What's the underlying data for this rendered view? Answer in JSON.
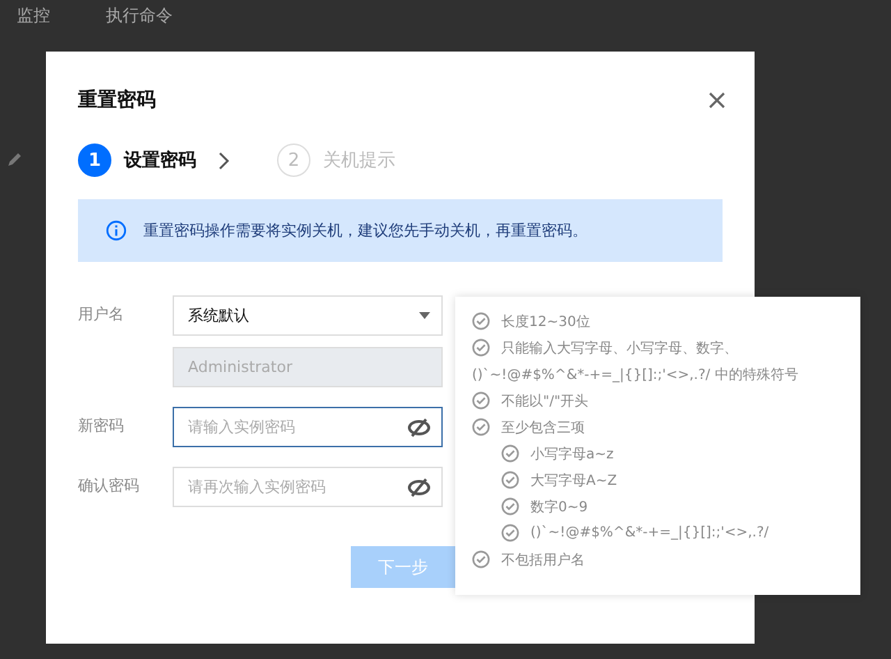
{
  "page_tabs": [
    {
      "label": "监控",
      "selected": false
    },
    {
      "label": "执行命令",
      "selected": false
    }
  ],
  "dialog": {
    "title": "重置密码",
    "steps": [
      {
        "number": "1",
        "label": "设置密码",
        "selected": true
      },
      {
        "number": "2",
        "label": "关机提示",
        "selected": false
      }
    ],
    "notice": "重置密码操作需要将实例关机，建议您先手动关机，再重置密码。",
    "form": {
      "username_label": "用户名",
      "username_select": "系统默认",
      "username_value": "Administrator",
      "new_password_label": "新密码",
      "new_password_placeholder": "请输入实例密码",
      "confirm_password_label": "确认密码",
      "confirm_password_placeholder": "请再次输入实例密码"
    },
    "next_button": "下一步"
  },
  "password_rules": [
    {
      "text": "长度12~30位",
      "met": false
    },
    {
      "text": "只能输入大写字母、小写字母、数字、",
      "continuation": "()`~!@#$%^&*-+=_|{}[]:;'<>,.?/ 中的特殊符号",
      "met": false
    },
    {
      "text": "不能以\"/\"开头",
      "met": false
    },
    {
      "text": "至少包含三项",
      "met": false,
      "children": [
        {
          "text": "小写字母a~z",
          "met": false
        },
        {
          "text": "大写字母A~Z",
          "met": false
        },
        {
          "text": "数字0~9",
          "met": false
        },
        {
          "text": "()`~!@#$%^&*-+=_|{}[]:;'<>,.?/",
          "met": false
        }
      ]
    },
    {
      "text": "不包括用户名",
      "met": false
    }
  ]
}
